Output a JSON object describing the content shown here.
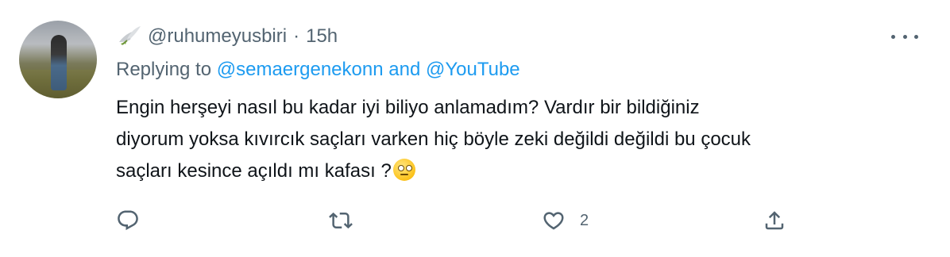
{
  "tweet": {
    "handle": "@ruhumeyusbiri",
    "separator": "·",
    "time": "15h",
    "replying_prefix": "Replying to",
    "reply_to_1": "@semaergenekonn",
    "reply_conj": "and",
    "reply_to_2": "@YouTube",
    "body_lines": [
      "Engin herşeyi nasıl bu kadar iyi biliyo anlamadım? Vardır bir bildiğiniz",
      "diyorum yoksa kıvırcık saçları varken hiç böyle zeki değildi  değildi bu çocuk",
      "saçları kesince açıldı mı kafası ?"
    ],
    "body_emoji": "face-with-rolling-eyes",
    "like_count": "2"
  },
  "colors": {
    "text": "#0f1419",
    "muted": "#536471",
    "link": "#1d9bf0"
  },
  "icons": {
    "name_icon": "dove-icon",
    "more": "more-icon",
    "reply": "reply-icon",
    "retweet": "retweet-icon",
    "like": "heart-icon",
    "share": "share-icon"
  }
}
